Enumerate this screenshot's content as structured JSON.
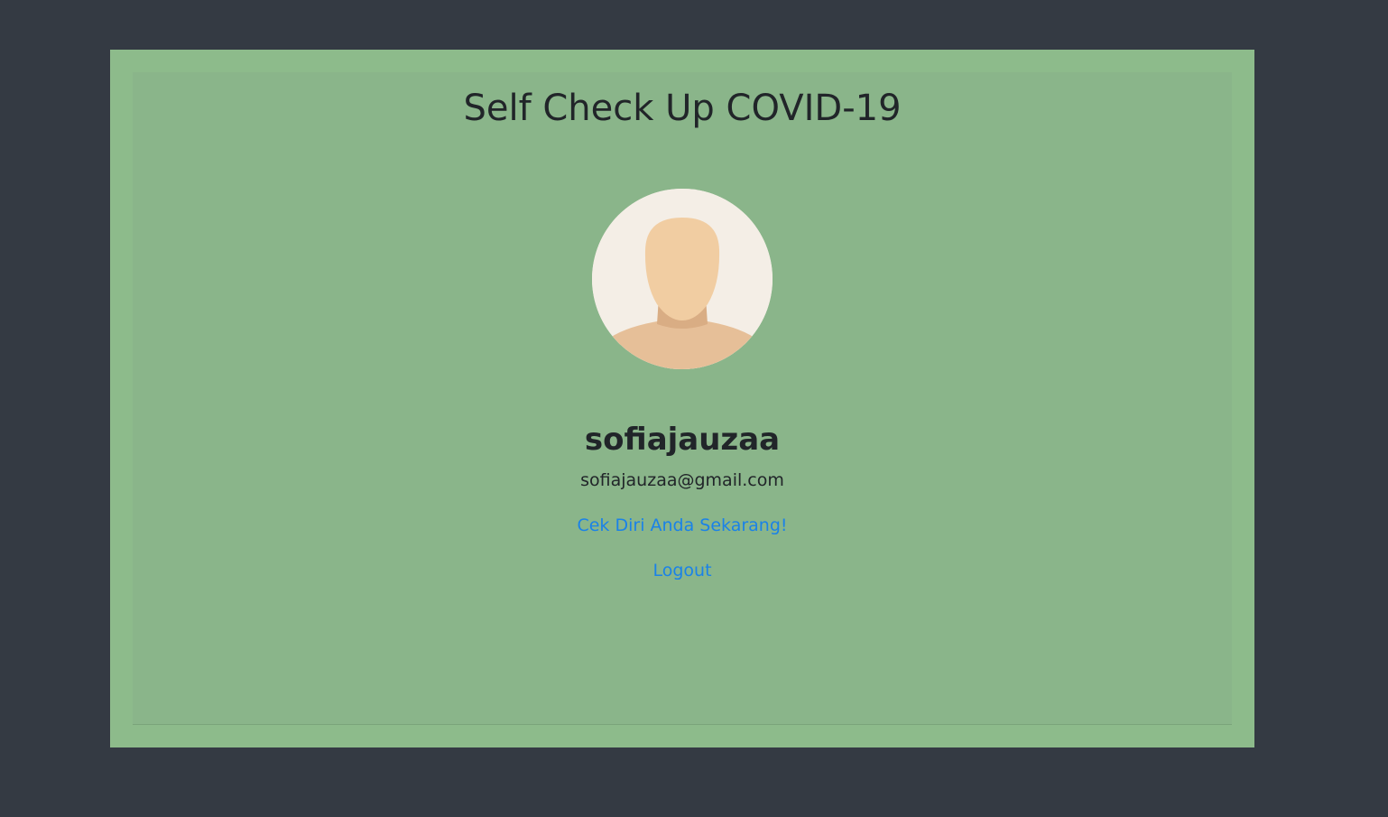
{
  "header": {
    "title": "Self Check Up COVID-19"
  },
  "profile": {
    "avatar_icon": "user-silhouette-icon",
    "username": "sofiajauzaa",
    "email": "sofiajauzaa@gmail.com"
  },
  "actions": {
    "check_link": "Cek Diri Anda Sekarang!",
    "logout_link": "Logout"
  },
  "colors": {
    "page_background": "#343a43",
    "panel_background": "#8dbb8b",
    "card_background": "#8ab58a",
    "link": "#1a82e8",
    "text": "#212529"
  }
}
